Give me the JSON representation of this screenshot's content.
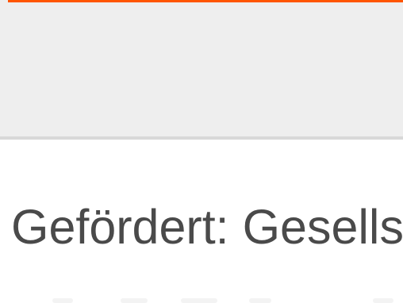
{
  "colors": {
    "accent": "#ff5500",
    "header_background": "#eeeeee",
    "divider": "#d8d8d8",
    "headline_text": "#4a4a4a",
    "page_background": "#ffffff"
  },
  "main": {
    "headline": "Gefördert: Gesells"
  }
}
